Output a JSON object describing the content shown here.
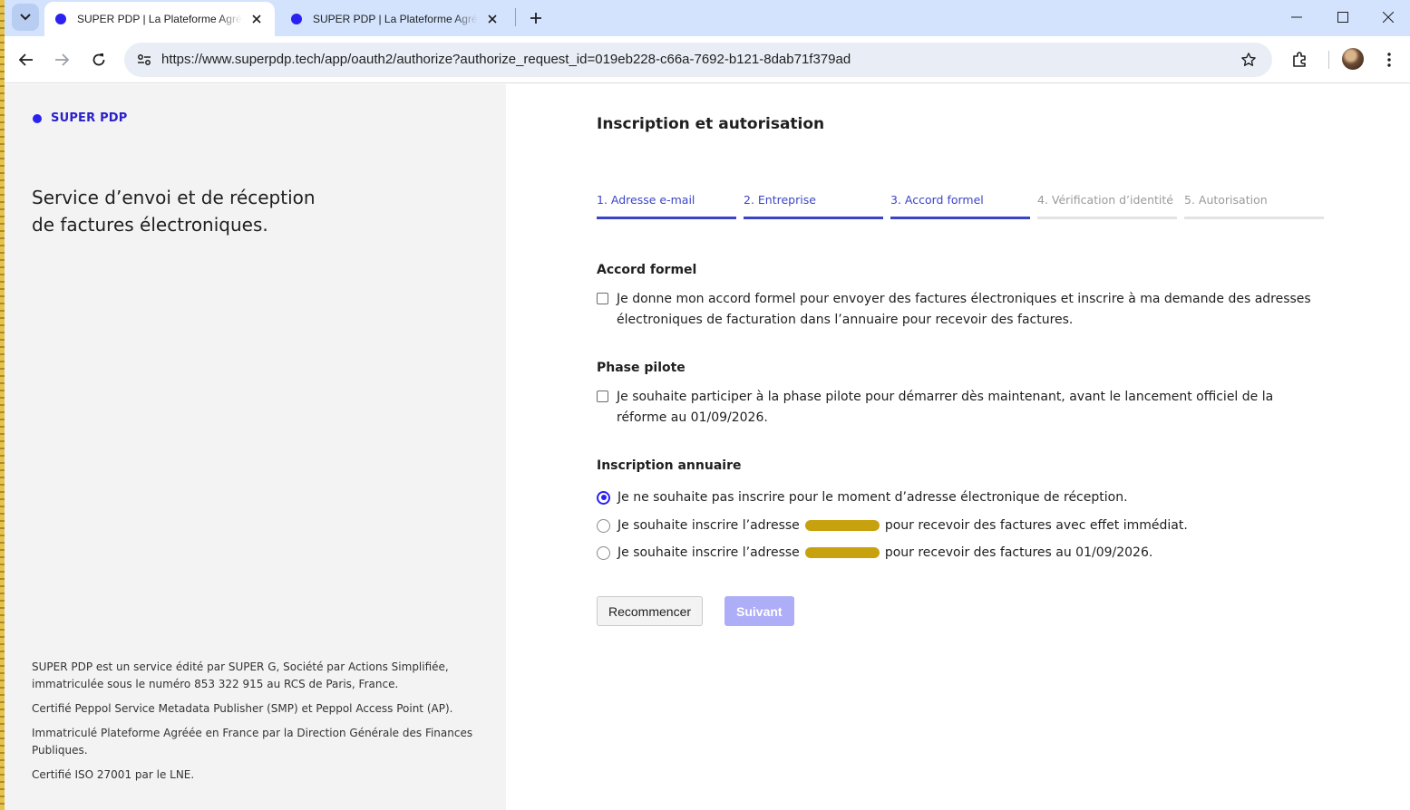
{
  "browser": {
    "tabs": [
      {
        "title": "SUPER PDP | La Plateforme Agréée",
        "active": true
      },
      {
        "title": "SUPER PDP | La Plateforme Agréée",
        "active": false
      }
    ],
    "url": "https://www.superpdp.tech/app/oauth2/authorize?authorize_request_id=019eb228-c66a-7692-b121-8dab71f379ad",
    "accent_color": "#d3e3fd"
  },
  "sidebar": {
    "brand": "SUPER PDP",
    "tagline": "Service d’envoi et de réception de factures électroniques.",
    "footer": [
      "SUPER PDP est un service édité par SUPER G, Société par Actions Simplifiée, immatriculée sous le numéro 853 322 915 au RCS de Paris, France.",
      "Certifié Peppol Service Metadata Publisher (SMP) et Peppol Access Point (AP).",
      "Immatriculé Plateforme Agréée en France par la Direction Générale des Finances Publiques.",
      "Certifié ISO 27001 par le LNE."
    ]
  },
  "main": {
    "title": "Inscription et autorisation",
    "steps": [
      {
        "label": "1. Adresse e-mail",
        "state": "done"
      },
      {
        "label": "2. Entreprise",
        "state": "done"
      },
      {
        "label": "3. Accord formel",
        "state": "current"
      },
      {
        "label": "4. Vérification d’identité",
        "state": "todo"
      },
      {
        "label": "5. Autorisation",
        "state": "todo"
      }
    ],
    "accord": {
      "label": "Accord formel",
      "checkbox_text": "Je donne mon accord formel pour envoyer des factures électroniques et inscrire à ma demande des adresses électroniques de facturation dans l’annuaire pour recevoir des factures.",
      "checked": false
    },
    "pilote": {
      "label": "Phase pilote",
      "checkbox_text": "Je souhaite participer à la phase pilote pour démarrer dès maintenant, avant le lancement officiel de la réforme au 01/09/2026.",
      "checked": false
    },
    "annuaire": {
      "label": "Inscription annuaire",
      "options": [
        {
          "prefix": "Je ne souhaite pas inscrire pour le moment d’adresse électronique de réception.",
          "suffix": "",
          "selected": true
        },
        {
          "prefix": "Je souhaite inscrire l’adresse",
          "suffix": "pour recevoir des factures avec effet immédiat.",
          "selected": false
        },
        {
          "prefix": "Je souhaite inscrire l’adresse",
          "suffix": "pour recevoir des factures au 01/09/2026.",
          "selected": false
        }
      ]
    },
    "buttons": {
      "restart": "Recommencer",
      "next": "Suivant"
    },
    "brand_color": "#2b21f0"
  }
}
